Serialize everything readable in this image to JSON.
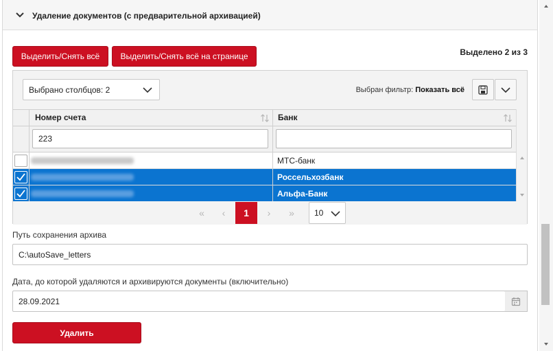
{
  "panel": {
    "title": "Удаление документов (с предварительной архивацией)"
  },
  "actions": {
    "select_all_label": "Выделить/Снять всё",
    "select_page_label": "Выделить/Снять всё на странице",
    "selected_count": "Выделено 2 из 3"
  },
  "grid": {
    "columns_select": "Выбрано столбцов: 2",
    "filter_prefix": "Выбран фильтр:",
    "filter_value": "Показать всё",
    "columns": [
      "Номер счета",
      "Банк"
    ],
    "filters": {
      "account": "223",
      "bank": ""
    },
    "rows": [
      {
        "checked": false,
        "bank": "МТС-банк"
      },
      {
        "checked": true,
        "bank": "Россельхозбанк"
      },
      {
        "checked": true,
        "bank": "Альфа-Банк"
      }
    ],
    "pager": {
      "first": "«",
      "prev": "‹",
      "current": "1",
      "next": "›",
      "last": "»",
      "page_size": "10"
    }
  },
  "archive_path": {
    "label": "Путь сохранения архива",
    "value": "C:\\autoSave_letters"
  },
  "date": {
    "label": "Дата, до которой удаляются и архивируются документы (включительно)",
    "value": "28.09.2021"
  },
  "delete_button": {
    "label": "Удалить"
  },
  "colors": {
    "accent": "#cc1022",
    "selection": "#0b74d0"
  }
}
